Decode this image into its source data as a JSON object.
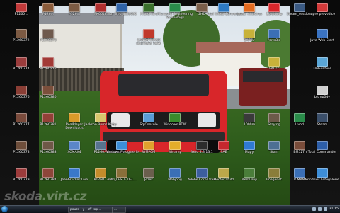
{
  "colors": {
    "taskbar": "#1a212b",
    "accent": "#1b69b3"
  },
  "desktop": {
    "icons": [
      {
        "id": "p1260",
        "label": "P1260...",
        "color": "#c23a3a",
        "col": 0,
        "row": 0
      },
      {
        "id": "p1260372",
        "label": "P1260372",
        "color": "#7c5a43",
        "col": 0,
        "row": 1
      },
      {
        "id": "p1260374",
        "label": "P1260374",
        "color": "#9a3c3c",
        "col": 0,
        "row": 2
      },
      {
        "id": "p1260376",
        "label": "P1260376",
        "color": "#8a3e35",
        "col": 0,
        "row": 3
      },
      {
        "id": "p1260377",
        "label": "P1260377",
        "color": "#7a4b3c",
        "col": 0,
        "row": 4
      },
      {
        "id": "p1260378",
        "label": "P1260378",
        "color": "#6e4e3b",
        "col": 0,
        "row": 5
      },
      {
        "id": "p1260379",
        "label": "P1260379",
        "color": "#9c3b3b",
        "col": 0,
        "row": 6
      },
      {
        "id": "c1_0",
        "label": "P126...",
        "color": "#8a5b3a",
        "col": 1,
        "row": 0
      },
      {
        "id": "c1_1",
        "label": "P1260373",
        "color": "#6f5a4d",
        "col": 1,
        "row": 1
      },
      {
        "id": "c1_2",
        "label": "P1260375",
        "color": "#a23a36",
        "col": 1,
        "row": 2
      },
      {
        "id": "c1_3",
        "label": "P1260380",
        "color": "#7b4f3b",
        "col": 1,
        "row": 3
      },
      {
        "id": "c1_4",
        "label": "P1260381",
        "color": "#934037",
        "col": 1,
        "row": 4
      },
      {
        "id": "c1_5",
        "label": "P1260383",
        "color": "#6f5847",
        "col": 1,
        "row": 5
      },
      {
        "id": "c1_6",
        "label": "P1260384",
        "color": "#8d463a",
        "col": 1,
        "row": 6
      },
      {
        "id": "c2_0",
        "label": "P126...",
        "color": "#7c5b43",
        "col": 2,
        "row": 0
      },
      {
        "id": "c2_4",
        "label": "RealPlayer Downloads",
        "color": "#d99a2a",
        "col": 2,
        "row": 4
      },
      {
        "id": "c2_5",
        "label": "XCMAX4",
        "color": "#5a86c8",
        "col": 2,
        "row": 5
      },
      {
        "id": "c2_6",
        "label": "Jeanbrucker Live",
        "color": "#3a78c9",
        "col": 2,
        "row": 6
      },
      {
        "id": "c3_0",
        "label": "PK0648",
        "color": "#b02e2e",
        "col": 3,
        "row": 0
      },
      {
        "id": "c3_4",
        "label": "Jackson Burns Kirby",
        "color": "#d8c66d",
        "col": 3,
        "row": 4
      },
      {
        "id": "c3_5",
        "label": "P1260...",
        "color": "#57738f",
        "col": 3,
        "row": 5
      },
      {
        "id": "c3_6",
        "label": "P1260...",
        "color": "#c58c2b",
        "col": 3,
        "row": 6
      },
      {
        "id": "c4_0",
        "label": "Star Trek_IBB9695",
        "color": "#2f63a8",
        "col": 4,
        "row": 0
      },
      {
        "id": "c4_5",
        "label": "Windows Fotogalerie",
        "color": "#3d8ed8",
        "col": 4,
        "row": 5
      },
      {
        "id": "c4_6",
        "label": "AMD_LESTE DEL...",
        "color": "#8a6f3a",
        "col": 4,
        "row": 6
      },
      {
        "id": "c5_0",
        "label": "PhotoFiltre",
        "color": "#3a6f2c",
        "col": 5,
        "row": 0
      },
      {
        "id": "c5_1",
        "label": "CANON IMAGE GATEWAY TASK",
        "color": "#c0392b",
        "col": 5,
        "row": 1
      },
      {
        "id": "c5_4",
        "label": "SqlConsole",
        "color": "#5a9dd6",
        "col": 5,
        "row": 4
      },
      {
        "id": "c5_5",
        "label": "WMP0M",
        "color": "#e0a12d",
        "col": 5,
        "row": 5
      },
      {
        "id": "c5_6",
        "label": "Jezek",
        "color": "#6a5f4d",
        "col": 5,
        "row": 6
      },
      {
        "id": "c6_0",
        "label": "Microsoft Engineering Technology",
        "color": "#2a8c4a",
        "col": 6,
        "row": 0
      },
      {
        "id": "c6_4",
        "label": "Windows PDW",
        "color": "#3a8c2c",
        "col": 6,
        "row": 4
      },
      {
        "id": "c6_5",
        "label": "Winamp",
        "color": "#e3ad2a",
        "col": 6,
        "row": 5
      },
      {
        "id": "c6_6",
        "label": "Mahjong",
        "color": "#3b6fb6",
        "col": 6,
        "row": 6
      },
      {
        "id": "c7_0",
        "label": "2HU",
        "color": "#7a5e4a",
        "col": 7,
        "row": 0
      },
      {
        "id": "c7_5",
        "label": "Nero 8.3.13.1",
        "color": "#2c2c2c",
        "col": 7,
        "row": 5
      },
      {
        "id": "c7_6",
        "label": "Adobe CorelDraw",
        "color": "#3c5e9e",
        "col": 7,
        "row": 6
      },
      {
        "id": "c8_0",
        "label": "Total Video Converter",
        "color": "#2d79c2",
        "col": 8,
        "row": 0
      },
      {
        "id": "c8_5",
        "label": "SAE",
        "color": "#c6282e",
        "col": 8,
        "row": 5
      },
      {
        "id": "c8_6",
        "label": "Doctor Stutz",
        "color": "#bca84a",
        "col": 8,
        "row": 6
      },
      {
        "id": "c9_0",
        "label": "avast! Antivirus",
        "color": "#e36a1f",
        "col": 9,
        "row": 0
      },
      {
        "id": "c9_1",
        "label": "BAPKU",
        "color": "#c8b23a",
        "col": 9,
        "row": 1
      },
      {
        "id": "c9_4",
        "label": "1000m",
        "color": "#3a3a3a",
        "col": 9,
        "row": 4
      },
      {
        "id": "c9_5",
        "label": "Mapy",
        "color": "#2f7ad3",
        "col": 9,
        "row": 5
      },
      {
        "id": "c9_6",
        "label": "MemDrop",
        "color": "#4a7e3a",
        "col": 9,
        "row": 6
      },
      {
        "id": "c10_0",
        "label": "CorelCorp",
        "color": "#d8262a",
        "col": 10,
        "row": 0
      },
      {
        "id": "c10_1",
        "label": "PortsBlo",
        "color": "#3b6fb6",
        "col": 10,
        "row": 1
      },
      {
        "id": "c10_2",
        "label": "VALKY",
        "color": "#c8b23a",
        "col": 10,
        "row": 2
      },
      {
        "id": "c10_4",
        "label": "Staying",
        "color": "#6c5a49",
        "col": 10,
        "row": 4
      },
      {
        "id": "c10_5",
        "label": "Stahl",
        "color": "#4d6f94",
        "col": 10,
        "row": 5
      },
      {
        "id": "c10_6",
        "label": "Imagenet",
        "color": "#8a7d3a",
        "col": 10,
        "row": 6
      },
      {
        "id": "c11_0",
        "label": "Steam_sessions",
        "color": "#3b5a83",
        "col": 11,
        "row": 0
      },
      {
        "id": "c11_4",
        "label": "Uvod",
        "color": "#2a8c4a",
        "col": 11,
        "row": 4
      },
      {
        "id": "c11_5",
        "label": "IBM52Th",
        "color": "#7a4c3a",
        "col": 11,
        "row": 5
      },
      {
        "id": "c11_6",
        "label": "TCMAMI",
        "color": "#3b6fb6",
        "col": 11,
        "row": 6
      },
      {
        "id": "r0",
        "label": "rapre prevodice",
        "color": "#d33a3a",
        "col": 12,
        "row": 0
      },
      {
        "id": "r1",
        "label": "Java Web Start",
        "color": "#3a73c2",
        "col": 12,
        "row": 1
      },
      {
        "id": "r2",
        "label": "TmGuntose",
        "color": "#5aa6d6",
        "col": 12,
        "row": 2
      },
      {
        "id": "r3",
        "label": "bitmp0dy",
        "color": "#d0d0d0",
        "col": 12,
        "row": 3
      },
      {
        "id": "r4",
        "label": "Steam",
        "color": "#3b4f6a",
        "col": 12,
        "row": 4
      },
      {
        "id": "r5",
        "label": "Total Commander",
        "color": "#2d5ea8",
        "col": 12,
        "row": 5
      },
      {
        "id": "r6",
        "label": "Windows Fotogalerie",
        "color": "#3d8ed8",
        "col": 12,
        "row": 6
      }
    ]
  },
  "watermark": {
    "text": "skoda.virt.cz"
  },
  "taskbar": {
    "buttons": [
      {
        "label": "pouze - y - off-top..."
      },
      {
        "label": "...",
        "w": 14
      }
    ],
    "clock": "21:15"
  }
}
